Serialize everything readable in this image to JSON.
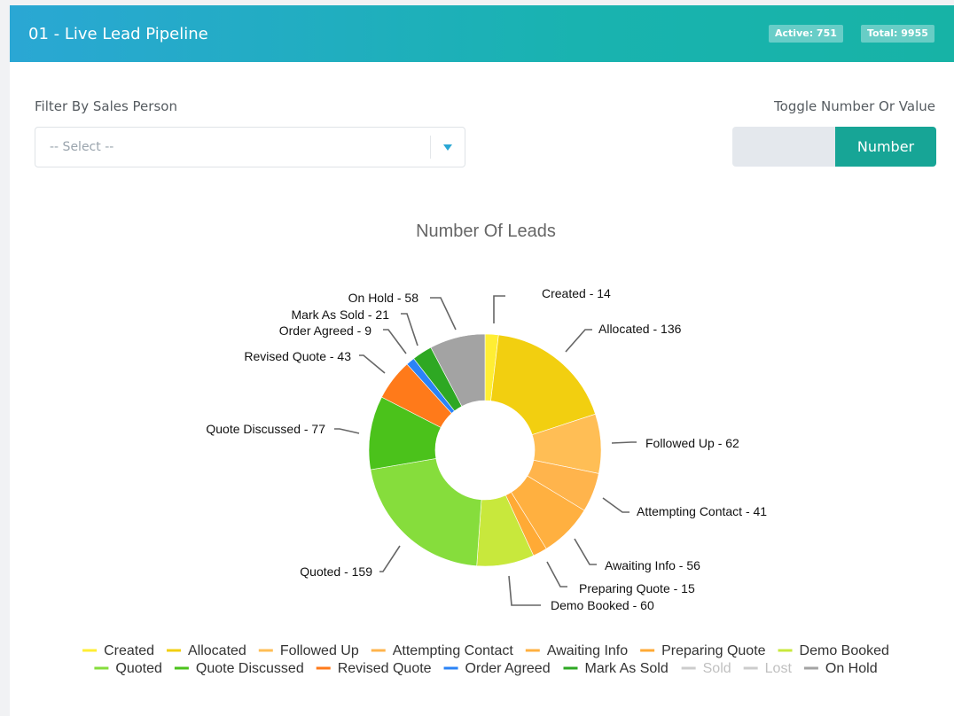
{
  "header": {
    "title": "01 - Live Lead Pipeline",
    "active_badge": "Active: 751",
    "total_badge": "Total: 9955"
  },
  "filter": {
    "label": "Filter By Sales Person",
    "placeholder": "-- Select --"
  },
  "toggle": {
    "label": "Toggle Number Or Value",
    "selected": "Number"
  },
  "chart_data": {
    "type": "pie",
    "title": "Number Of Leads",
    "series": [
      {
        "name": "Created",
        "value": 14,
        "color": "#ffee33"
      },
      {
        "name": "Allocated",
        "value": 136,
        "color": "#f2cf10"
      },
      {
        "name": "Followed Up",
        "value": 62,
        "color": "#ffbe55"
      },
      {
        "name": "Attempting Contact",
        "value": 41,
        "color": "#ffb44c"
      },
      {
        "name": "Awaiting Info",
        "value": 56,
        "color": "#ffb040"
      },
      {
        "name": "Preparing Quote",
        "value": 15,
        "color": "#ffaa35"
      },
      {
        "name": "Demo Booked",
        "value": 60,
        "color": "#c8e83c"
      },
      {
        "name": "Quoted",
        "value": 159,
        "color": "#86dd3c"
      },
      {
        "name": "Quote Discussed",
        "value": 77,
        "color": "#4bc21b"
      },
      {
        "name": "Revised Quote",
        "value": 43,
        "color": "#ff7a1a"
      },
      {
        "name": "Order Agreed",
        "value": 9,
        "color": "#2b83f6"
      },
      {
        "name": "Mark As Sold",
        "value": 21,
        "color": "#2ea823"
      },
      {
        "name": "Sold",
        "value": 0,
        "color": "#a8a8a8",
        "hidden": true
      },
      {
        "name": "Lost",
        "value": 0,
        "color": "#a8a8a8",
        "hidden": true
      },
      {
        "name": "On Hold",
        "value": 58,
        "color": "#a3a3a3"
      }
    ],
    "data_labels": [
      "Created - 14",
      "Allocated - 136",
      "Followed Up - 62",
      "Attempting Contact - 41",
      "Awaiting Info - 56",
      "Preparing Quote - 15",
      "Demo Booked - 60",
      "Quoted - 159",
      "Quote Discussed - 77",
      "Revised Quote - 43",
      "Order Agreed - 9",
      "Mark As Sold - 21",
      "",
      "",
      "On Hold - 58"
    ],
    "legend_placement": "bottom"
  }
}
